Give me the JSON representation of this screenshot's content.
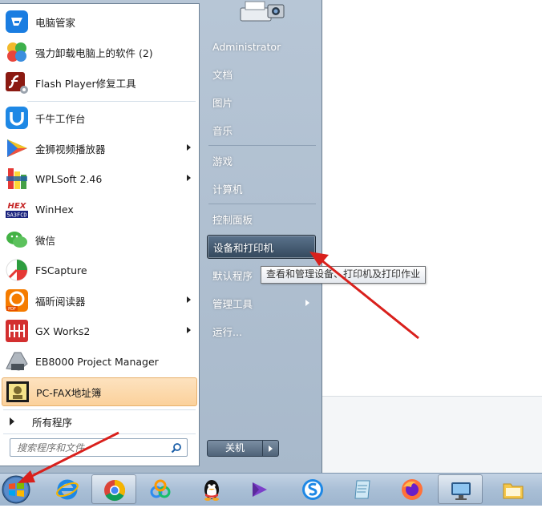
{
  "start_menu": {
    "programs": [
      {
        "label": "电脑管家",
        "icon": "tencent-pc-manager-icon",
        "has_submenu": false
      },
      {
        "label": "强力卸载电脑上的软件 (2)",
        "icon": "uninstall-clover-icon",
        "has_submenu": false
      },
      {
        "label": "Flash Player修复工具",
        "icon": "flash-player-icon",
        "has_submenu": false
      },
      {
        "label": "千牛工作台",
        "icon": "qianniu-icon",
        "has_submenu": false
      },
      {
        "label": "金狮视频播放器",
        "icon": "video-player-icon",
        "has_submenu": true
      },
      {
        "label": "WPLSoft 2.46",
        "icon": "wplsoft-icon",
        "has_submenu": true
      },
      {
        "label": "WinHex",
        "icon": "winhex-icon",
        "has_submenu": false
      },
      {
        "label": "微信",
        "icon": "wechat-icon",
        "has_submenu": false
      },
      {
        "label": "FSCapture",
        "icon": "fscapture-icon",
        "has_submenu": false
      },
      {
        "label": "福昕阅读器",
        "icon": "foxit-reader-icon",
        "has_submenu": true
      },
      {
        "label": "GX Works2",
        "icon": "gx-works-icon",
        "has_submenu": true
      },
      {
        "label": "EB8000 Project Manager",
        "icon": "eb8000-icon",
        "has_submenu": false
      },
      {
        "label": "PC-FAX地址簿",
        "icon": "pc-fax-icon",
        "has_submenu": false,
        "highlighted": true
      }
    ],
    "all_programs_label": "所有程序",
    "search_placeholder": "搜索程序和文件",
    "right_pane": {
      "user": "Administrator",
      "items": [
        {
          "label": "文档"
        },
        {
          "label": "图片"
        },
        {
          "label": "音乐"
        },
        {
          "label": "游戏"
        },
        {
          "label": "计算机"
        },
        {
          "label": "控制面板"
        },
        {
          "label": "设备和打印机",
          "highlighted": true
        },
        {
          "label": "默认程序"
        },
        {
          "label": "管理工具",
          "has_submenu": true
        },
        {
          "label": "运行..."
        }
      ]
    },
    "shutdown_label": "关机",
    "tooltip": "查看和管理设备、打印机及打印作业"
  },
  "taskbar": {
    "start_button": "windows-orb-icon",
    "pinned": [
      {
        "name": "internet-explorer-icon",
        "active": false
      },
      {
        "name": "chrome-icon",
        "active": true
      },
      {
        "name": "baidu-netdisk-icon",
        "active": false
      },
      {
        "name": "qq-penguin-icon",
        "active": false
      },
      {
        "name": "visual-studio-icon",
        "active": false
      },
      {
        "name": "sogou-browser-icon",
        "active": false
      },
      {
        "name": "notepad-icon",
        "active": false
      },
      {
        "name": "firefox-icon",
        "active": false
      },
      {
        "name": "remote-desktop-icon",
        "active": false
      },
      {
        "name": "file-explorer-icon",
        "active": false
      }
    ]
  },
  "colors": {
    "annotation_arrow": "#d9201c",
    "highlight_orange": "#fbd19b",
    "menu_right_pane": "#a8b9cb"
  }
}
